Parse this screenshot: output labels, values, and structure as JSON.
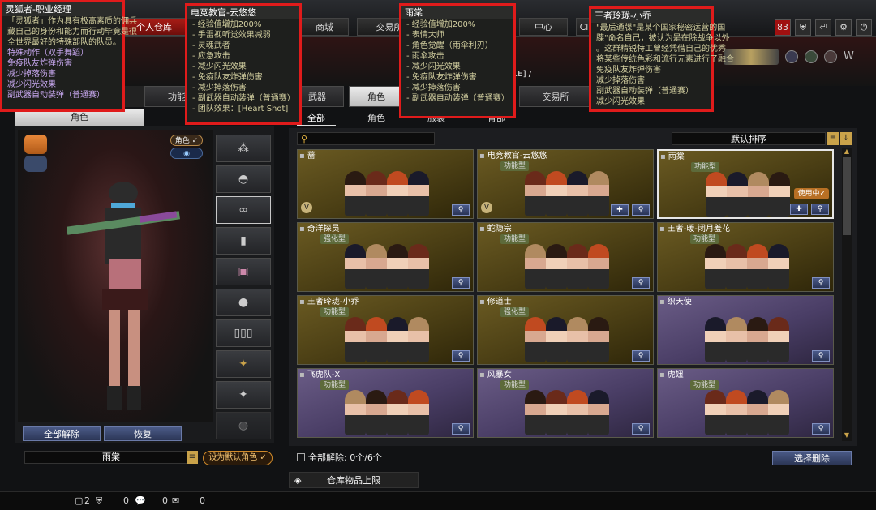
{
  "top_nav": {
    "tabs": [
      "个人仓库",
      "商城",
      "交易所",
      "中心",
      "Cl"
    ],
    "level": "83"
  },
  "ticker": {
    "text": "] / MK5-T[SA ... IL-S[SALE] /"
  },
  "left": {
    "tab_character": "角色",
    "tab_function": "功能",
    "chip_role": "角色 ✓",
    "btn_unequip_all": "全部解除",
    "btn_restore": "恢复",
    "char_name": "雨棠",
    "btn_set_default": "设为默认角色 ✓"
  },
  "sub_tabs": [
    "武器",
    "角色",
    "交易所"
  ],
  "categories": [
    "全部",
    "角色",
    "服装",
    "背部"
  ],
  "sort_label": "默认排序",
  "cards": [
    {
      "name": "蔷",
      "badge": "",
      "theme": "gold",
      "in_use": false
    },
    {
      "name": "电竞教官-云悠悠",
      "badge": "功能型",
      "theme": "gold",
      "in_use": false
    },
    {
      "name": "雨棠",
      "badge": "功能型",
      "theme": "gold",
      "in_use": true
    },
    {
      "name": "奇洋探员",
      "badge": "强化型",
      "theme": "gold",
      "in_use": false
    },
    {
      "name": "蛇隐宗",
      "badge": "功能型",
      "theme": "gold",
      "in_use": false
    },
    {
      "name": "王者-暖-闭月羞花",
      "badge": "功能型",
      "theme": "gold",
      "in_use": false
    },
    {
      "name": "王者玲珑-小乔",
      "badge": "功能型",
      "theme": "gold",
      "in_use": false
    },
    {
      "name": "修道士",
      "badge": "强化型",
      "theme": "gold",
      "in_use": false
    },
    {
      "name": "织天使",
      "badge": "",
      "theme": "purple",
      "in_use": false
    },
    {
      "name": "飞虎队-X",
      "badge": "功能型",
      "theme": "purple",
      "in_use": false
    },
    {
      "name": "风暴女",
      "badge": "功能型",
      "theme": "purple",
      "in_use": false
    },
    {
      "name": "虎妞",
      "badge": "功能型",
      "theme": "purple",
      "in_use": false
    }
  ],
  "in_use_label": "使用中✓",
  "footer": {
    "unequip_count": "全部解除: 0个/6个",
    "btn_select_delete": "选择删除",
    "warehouse_limit": "仓库物品上限",
    "stats": [
      "2",
      "0",
      "0",
      "0"
    ]
  },
  "tooltips": [
    {
      "title": "灵狐者-职业经理",
      "lines": [
        "「灵狐者」作为具有极高素质的佣兵",
        "藏自己的身份和能力而行动毕竟是很",
        "全世界最好的特殊部队的队员。",
        "特殊动作（双手舞蹈）",
        "免疫队友炸弹伤害",
        "减少掉落伤害",
        "减少闪光效果",
        "副武器自动装弹（普通赛）"
      ]
    },
    {
      "title": "电竞教官-云悠悠",
      "lines": [
        "- 经验值增加200%",
        "- 手雷视听觉效果减弱",
        "- 灵魂武者",
        "- 应急攻击",
        "- 减少闪光效果",
        "- 免疫队友炸弹伤害",
        "- 减少掉落伤害",
        "- 副武器自动装弹（普通赛）",
        "- 团队效果：[Heart Shot]"
      ]
    },
    {
      "title": "雨棠",
      "lines": [
        "- 经验值增加200%",
        "- 表情大师",
        "- 角色觉醒（雨伞利刃）",
        "- 雨伞攻击",
        "- 减少闪光效果",
        "- 免疫队友炸弹伤害",
        "- 减少掉落伤害",
        "- 副武器自动装弹（普通赛）"
      ]
    },
    {
      "title": "王者玲珑-小乔",
      "lines": [
        "\"最后通牒\"是某个国家秘密运营的国",
        "牒\"命名自己，被认为是在除战争以外",
        "。这群精锐特工曾经凭借自己的优秀",
        "将某些传统色彩和流行元素进行了融合",
        "免疫队友炸弹伤害",
        "减少掉落伤害",
        "副武器自动装弹（普通赛）",
        "减少闪光效果"
      ]
    }
  ],
  "colors": {
    "accent_red": "#e01b1b",
    "tab_red": "#a81c16",
    "gold": "#6a5a22",
    "purple": "#6a5c86"
  }
}
